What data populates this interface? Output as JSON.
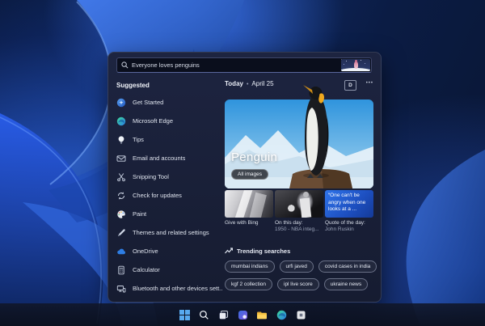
{
  "search_panel": {
    "search_box": {
      "value": "Everyone loves penguins",
      "icon": "search"
    },
    "suggested": {
      "header": "Suggested",
      "items": [
        {
          "label": "Get Started",
          "icon": "get-started"
        },
        {
          "label": "Microsoft Edge",
          "icon": "edge"
        },
        {
          "label": "Tips",
          "icon": "lightbulb"
        },
        {
          "label": "Email and accounts",
          "icon": "envelope"
        },
        {
          "label": "Snipping Tool",
          "icon": "scissors"
        },
        {
          "label": "Check for updates",
          "icon": "sync-arrows"
        },
        {
          "label": "Paint",
          "icon": "palette"
        },
        {
          "label": "Themes and related settings",
          "icon": "pen"
        },
        {
          "label": "OneDrive",
          "icon": "cloud"
        },
        {
          "label": "Calculator",
          "icon": "calculator"
        },
        {
          "label": "Bluetooth and other devices sett...",
          "icon": "devices"
        }
      ]
    },
    "daily": {
      "today_label": "Today",
      "separator": "•",
      "date": "April 25",
      "profile_button": "D",
      "more_button": "•••",
      "hero": {
        "title": "Penguin",
        "all_images_button": "All images"
      },
      "cards": [
        {
          "caption1": "Give with Bing"
        },
        {
          "caption1": "On this day:",
          "caption2": "1950 - NBA integ..."
        },
        {
          "quote": "“One can't be angry when one looks at a ...",
          "caption1": "Quote of the day:",
          "caption2": "John Ruskin"
        }
      ],
      "trending": {
        "header": "Trending searches",
        "chips": [
          "mumbai indians",
          "urfi javed",
          "covid cases in india",
          "kgf 2 collection",
          "ipl live score",
          "ukraine news"
        ]
      }
    }
  },
  "taskbar": {
    "icons": [
      "start",
      "search",
      "task-view",
      "widgets",
      "file-explorer",
      "edge",
      "store-app"
    ]
  },
  "colors": {
    "accent_blue": "#2f74ea",
    "panel_bg": "#181f36",
    "edge_teal": "#3ddc97",
    "folder_yellow": "#f6c242"
  }
}
